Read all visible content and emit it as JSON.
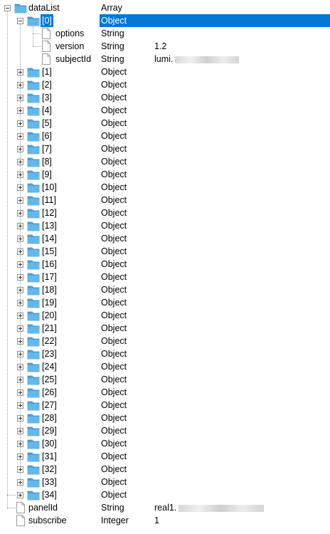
{
  "tree": {
    "root": {
      "name": "dataList",
      "type": "Array"
    },
    "first_item": {
      "name": "[0]",
      "type": "Object"
    },
    "first_item_fields": [
      {
        "name": "options",
        "type": "String",
        "value": ""
      },
      {
        "name": "version",
        "type": "String",
        "value": "1.2"
      },
      {
        "name": "subjectId",
        "type": "String",
        "value": "lumi."
      }
    ],
    "items": [
      {
        "name": "[1]",
        "type": "Object"
      },
      {
        "name": "[2]",
        "type": "Object"
      },
      {
        "name": "[3]",
        "type": "Object"
      },
      {
        "name": "[4]",
        "type": "Object"
      },
      {
        "name": "[5]",
        "type": "Object"
      },
      {
        "name": "[6]",
        "type": "Object"
      },
      {
        "name": "[7]",
        "type": "Object"
      },
      {
        "name": "[8]",
        "type": "Object"
      },
      {
        "name": "[9]",
        "type": "Object"
      },
      {
        "name": "[10]",
        "type": "Object"
      },
      {
        "name": "[11]",
        "type": "Object"
      },
      {
        "name": "[12]",
        "type": "Object"
      },
      {
        "name": "[13]",
        "type": "Object"
      },
      {
        "name": "[14]",
        "type": "Object"
      },
      {
        "name": "[15]",
        "type": "Object"
      },
      {
        "name": "[16]",
        "type": "Object"
      },
      {
        "name": "[17]",
        "type": "Object"
      },
      {
        "name": "[18]",
        "type": "Object"
      },
      {
        "name": "[19]",
        "type": "Object"
      },
      {
        "name": "[20]",
        "type": "Object"
      },
      {
        "name": "[21]",
        "type": "Object"
      },
      {
        "name": "[22]",
        "type": "Object"
      },
      {
        "name": "[23]",
        "type": "Object"
      },
      {
        "name": "[24]",
        "type": "Object"
      },
      {
        "name": "[25]",
        "type": "Object"
      },
      {
        "name": "[26]",
        "type": "Object"
      },
      {
        "name": "[27]",
        "type": "Object"
      },
      {
        "name": "[28]",
        "type": "Object"
      },
      {
        "name": "[29]",
        "type": "Object"
      },
      {
        "name": "[30]",
        "type": "Object"
      },
      {
        "name": "[31]",
        "type": "Object"
      },
      {
        "name": "[32]",
        "type": "Object"
      },
      {
        "name": "[33]",
        "type": "Object"
      },
      {
        "name": "[34]",
        "type": "Object"
      }
    ],
    "root_fields": [
      {
        "name": "panelId",
        "type": "String",
        "value": "real1."
      },
      {
        "name": "subscribe",
        "type": "Integer",
        "value": "1"
      }
    ]
  },
  "colors": {
    "selection": "#0078d7",
    "folder_fill": "#63b8ea",
    "folder_tab": "#4aa3df",
    "dotted_line": "#a0a0a0"
  }
}
